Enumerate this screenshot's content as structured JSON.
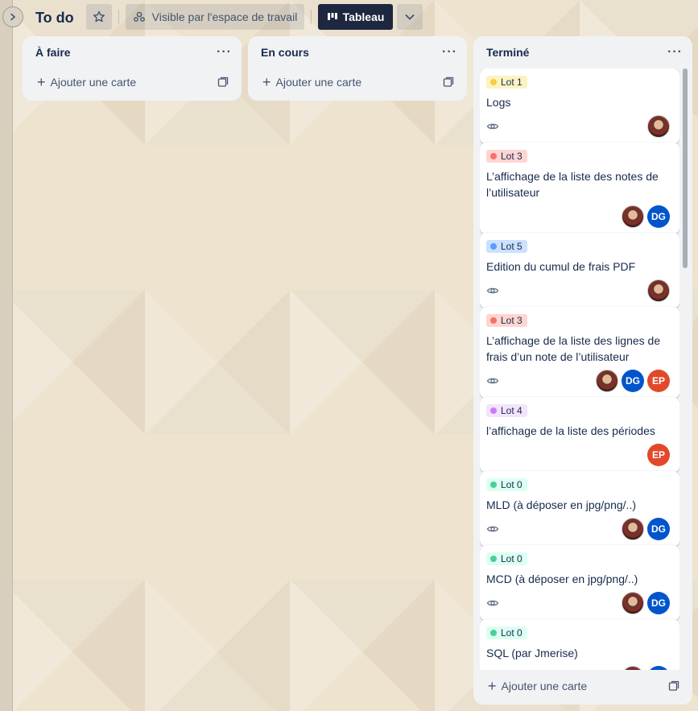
{
  "board": {
    "title": "To do",
    "visibility": "Visible par l'espace de travail",
    "view": "Tableau"
  },
  "icons": [
    "expand-icon",
    "star-icon",
    "workspace-icon",
    "board-icon",
    "chevron-down-icon",
    "more-icon",
    "plus-icon",
    "template-icon",
    "eye-icon"
  ],
  "lists": [
    {
      "title": "À faire",
      "menu": "···",
      "add": "Ajouter une carte"
    },
    {
      "title": "En cours",
      "menu": "···",
      "add": "Ajouter une carte"
    },
    {
      "title": "Terminé",
      "menu": "···",
      "add": "Ajouter une carte",
      "cards": [
        {
          "label": "Lot 1",
          "label_color": "#f5cd47",
          "label_bg": "#fbf3c0",
          "title": "Logs",
          "watch": true,
          "members": [
            "photo"
          ]
        },
        {
          "label": "Lot 3",
          "label_color": "#f87168",
          "label_bg": "#ffd5d2",
          "title": "L’affichage de la liste des notes de l’utilisateur",
          "watch": false,
          "members": [
            "photo",
            "DG"
          ]
        },
        {
          "label": "Lot 5",
          "label_color": "#579dff",
          "label_bg": "#cce0ff",
          "title": "Edition du cumul de frais PDF",
          "watch": true,
          "members": [
            "photo"
          ]
        },
        {
          "label": "Lot 3",
          "label_color": "#f87168",
          "label_bg": "#ffd5d2",
          "title": "L’affichage de la liste des lignes de frais d’un note de l’utilisateur",
          "watch": true,
          "members": [
            "photo",
            "DG",
            "EP"
          ]
        },
        {
          "label": "Lot 4",
          "label_color": "#c97cf4",
          "label_bg": "#f3e3fb",
          "title": "l’affichage de la liste des périodes",
          "watch": false,
          "members": [
            "EP"
          ]
        },
        {
          "label": "Lot 0",
          "label_color": "#4bce97",
          "label_bg": "#dcfff1",
          "title": "MLD (à déposer en jpg/png/..)",
          "watch": true,
          "members": [
            "photo",
            "DG"
          ]
        },
        {
          "label": "Lot 0",
          "label_color": "#4bce97",
          "label_bg": "#dcfff1",
          "title": "MCD (à déposer en jpg/png/..)",
          "watch": true,
          "members": [
            "photo",
            "DG"
          ]
        },
        {
          "label": "Lot 0",
          "label_color": "#4bce97",
          "label_bg": "#dcfff1",
          "title": "SQL (par Jmerise)",
          "watch": true,
          "members": [
            "photo",
            "DG"
          ]
        }
      ]
    }
  ]
}
